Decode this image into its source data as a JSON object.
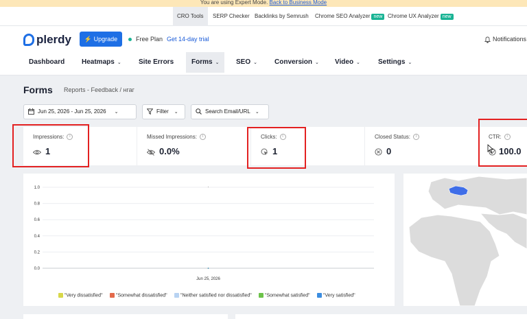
{
  "banner": {
    "text": "You are using Expert Mode.",
    "link": "Back to Business Mode"
  },
  "top_tabs": [
    {
      "label": "CRO Tools",
      "active": true,
      "new": false
    },
    {
      "label": "SERP Checker",
      "active": false,
      "new": false
    },
    {
      "label": "Backlinks by Semrush",
      "active": false,
      "new": false
    },
    {
      "label": "Chrome SEO Analyzer",
      "active": false,
      "new": true
    },
    {
      "label": "Chrome UX Analyzer",
      "active": false,
      "new": true
    }
  ],
  "new_badge": "new",
  "header": {
    "logo": "plerdy",
    "upgrade": "Upgrade",
    "plan": "Free Plan",
    "trial": "Get 14-day trial",
    "notifications": "Notifications"
  },
  "nav": [
    {
      "label": "Dashboard",
      "dropdown": false,
      "active": false
    },
    {
      "label": "Heatmaps",
      "dropdown": true,
      "active": false
    },
    {
      "label": "Site Errors",
      "dropdown": false,
      "active": false
    },
    {
      "label": "Forms",
      "dropdown": true,
      "active": true
    },
    {
      "label": "SEO",
      "dropdown": true,
      "active": false
    },
    {
      "label": "Conversion",
      "dropdown": true,
      "active": false
    },
    {
      "label": "Video",
      "dropdown": true,
      "active": false
    },
    {
      "label": "Settings",
      "dropdown": true,
      "active": false
    }
  ],
  "page": {
    "title": "Forms",
    "breadcrumb": "Reports - Feedback / нгаг"
  },
  "filters": {
    "date_range": "Jun 25, 2026 - Jun 25, 2026",
    "filter": "Filter",
    "search": "Search Email/URL"
  },
  "stats": [
    {
      "label": "Impressions:",
      "value": "1",
      "icon": "eye-icon"
    },
    {
      "label": "Missed Impressions:",
      "value": "0.0%",
      "icon": "eye-off-icon"
    },
    {
      "label": "Clicks:",
      "value": "1",
      "icon": "click-icon"
    },
    {
      "label": "Closed Status:",
      "value": "0",
      "icon": "close-circle-icon"
    },
    {
      "label": "CTR:",
      "value": "100.0",
      "icon": "ctr-icon"
    }
  ],
  "colors": {
    "accent": "#1e6fe5",
    "highlight": "#e32020",
    "map_highlight": "#3f6ee8",
    "map_land": "#dcdcdc"
  },
  "chart_data": {
    "type": "line",
    "x": [
      "Jun 25, 2026"
    ],
    "ylim": [
      0,
      1.0
    ],
    "yticks": [
      "1.0",
      "0.8",
      "0.6",
      "0.4",
      "0.2",
      "0.0"
    ],
    "series": [
      {
        "name": "\"Very dissatisfied\"",
        "color": "#d8d84a",
        "values": [
          0
        ]
      },
      {
        "name": "\"Somewhat dissatisfied\"",
        "color": "#e36a4b",
        "values": [
          0
        ]
      },
      {
        "name": "\"Neither satisfied nor dissatisfied\"",
        "color": "#b8d3f2",
        "values": [
          0
        ]
      },
      {
        "name": "\"Somewhat satisfied\"",
        "color": "#6cc24a",
        "values": [
          0
        ]
      },
      {
        "name": "\"Very satisfied\"",
        "color": "#3c8de0",
        "values": [
          0
        ]
      }
    ],
    "grid": true,
    "legend": "bottom"
  }
}
